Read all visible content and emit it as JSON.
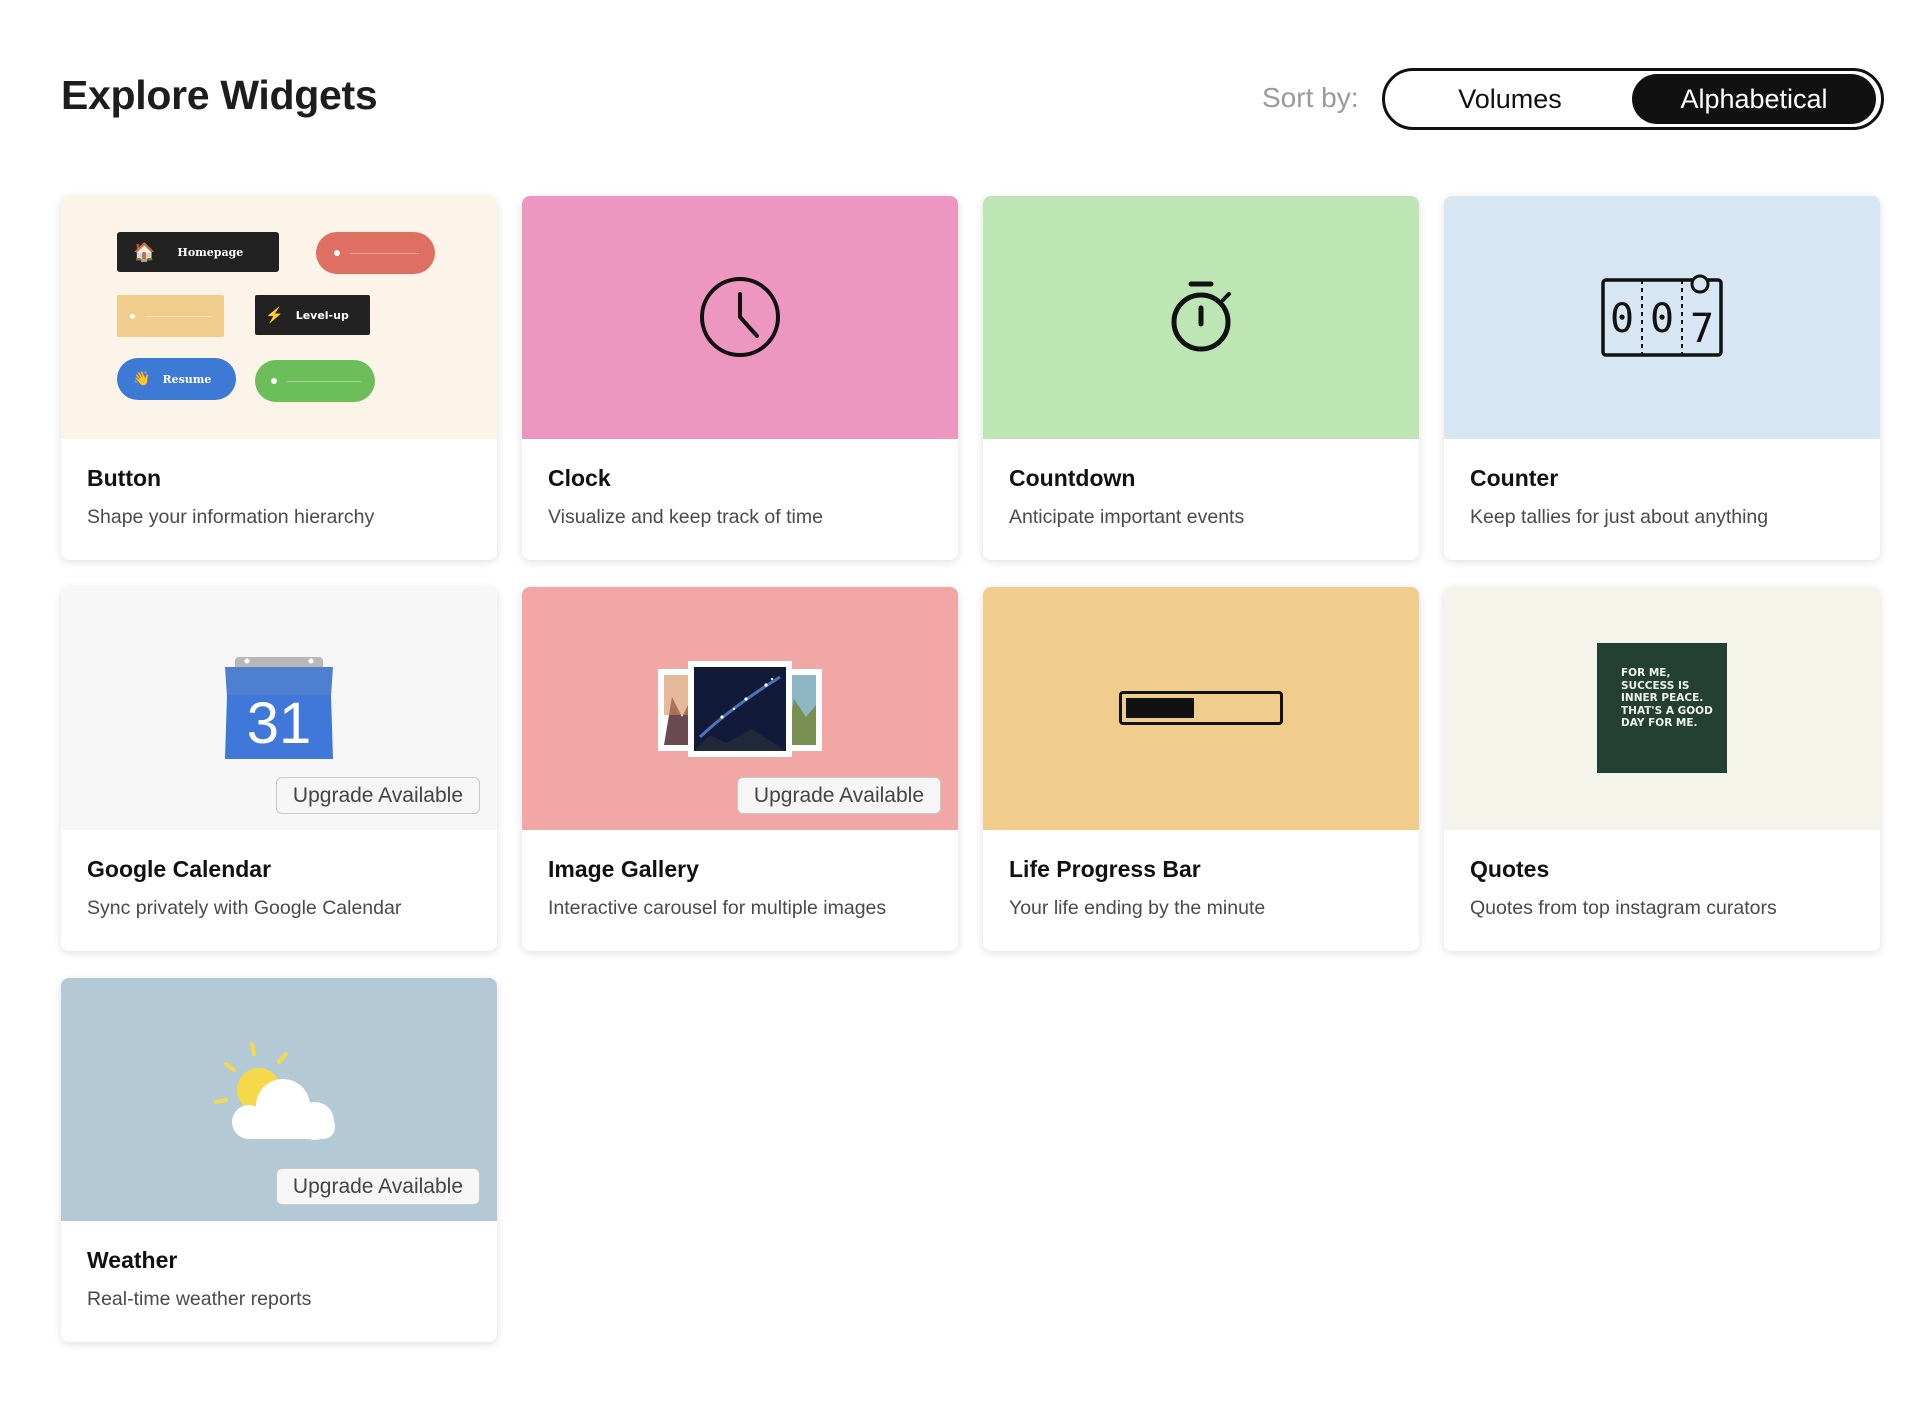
{
  "header": {
    "title": "Explore Widgets",
    "sort_label": "Sort by:",
    "sort_options": [
      "Volumes",
      "Alphabetical"
    ],
    "sort_selected": "Alphabetical"
  },
  "upgrade_badge": "Upgrade Available",
  "widgets": [
    {
      "title": "Button",
      "description": "Shape your information hierarchy",
      "thumb_color": "#fcf4e8",
      "preview": {
        "homepage": "Homepage",
        "levelup": "Level-up",
        "resume": "Resume"
      }
    },
    {
      "title": "Clock",
      "description": "Visualize and keep track of time",
      "thumb_color": "#ec96c0"
    },
    {
      "title": "Countdown",
      "description": "Anticipate important events",
      "thumb_color": "#bee6b4"
    },
    {
      "title": "Counter",
      "description": "Keep tallies for just about anything",
      "thumb_color": "#d6e6f2",
      "preview": {
        "digits": [
          "0",
          "0",
          "7"
        ]
      }
    },
    {
      "title": "Google Calendar",
      "description": "Sync privately with Google Calendar",
      "thumb_color": "#f7f7f7",
      "upgrade": true,
      "preview": {
        "day": "31"
      }
    },
    {
      "title": "Image Gallery",
      "description": "Interactive carousel for multiple images",
      "thumb_color": "#f0a7a6",
      "upgrade": true
    },
    {
      "title": "Life Progress Bar",
      "description": "Your life ending by the minute",
      "thumb_color": "#f0cc8d",
      "preview": {
        "progress": 0.45
      }
    },
    {
      "title": "Quotes",
      "description": "Quotes from top instagram curators",
      "thumb_color": "#f5f4ea",
      "preview": {
        "quote": "FOR ME, SUCCESS IS INNER PEACE. THAT'S A GOOD DAY FOR ME."
      }
    },
    {
      "title": "Weather",
      "description": "Real-time weather reports",
      "thumb_color": "#b3c9d5",
      "upgrade": true
    }
  ]
}
